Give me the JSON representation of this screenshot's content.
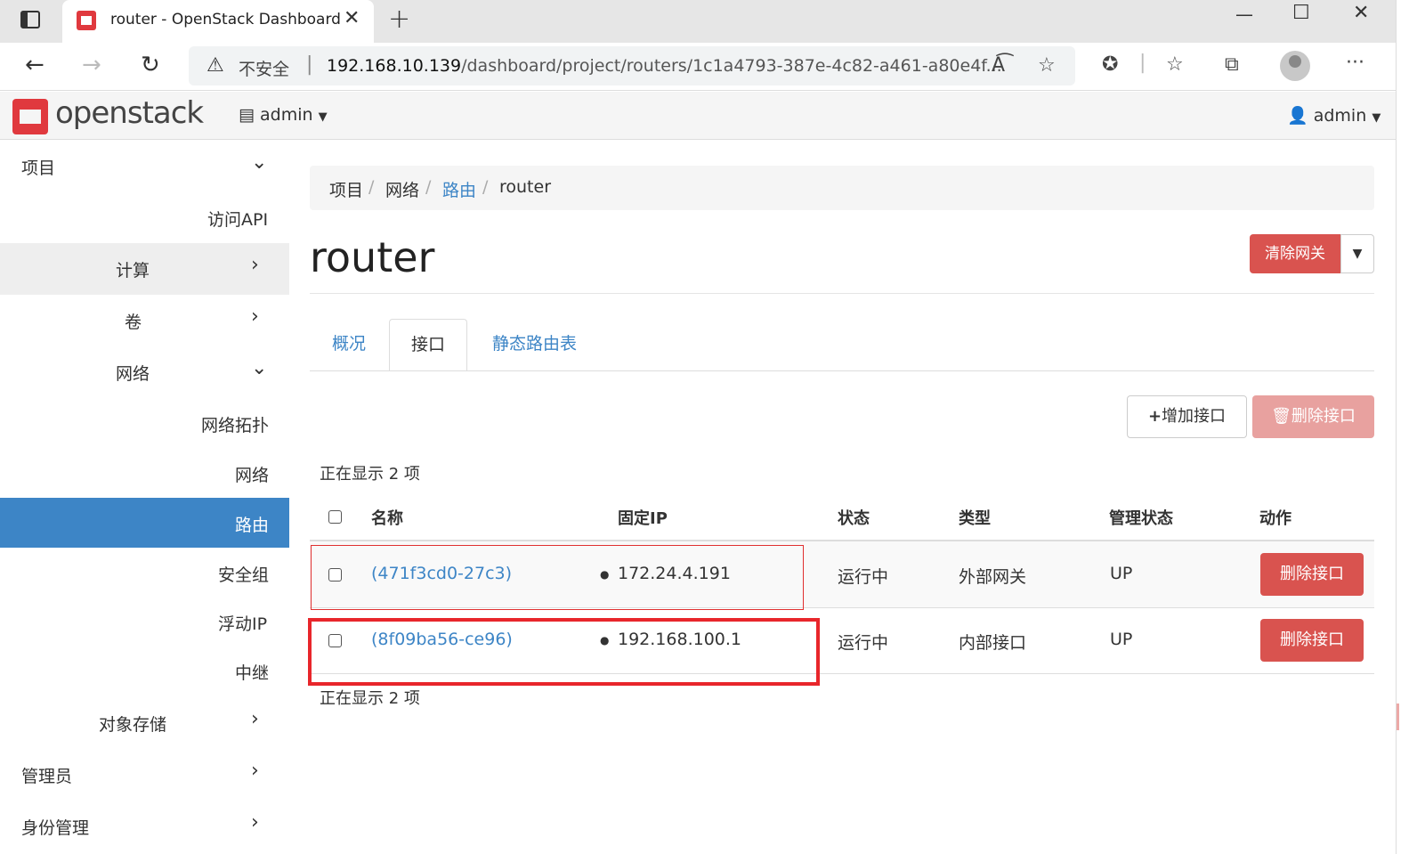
{
  "browser": {
    "tab_title": "router - OpenStack Dashboard",
    "insecure_label": "不安全",
    "url_host": "192.168.10.139",
    "url_path": "/dashboard/project/routers/1c1a4793-387e-4c82-a461-a80e4f..."
  },
  "header": {
    "logo_text": "openstack",
    "project_selector": "admin",
    "user_menu": "admin"
  },
  "sidebar": {
    "project": "项目",
    "api_access": "访问API",
    "compute": "计算",
    "volumes": "卷",
    "network": "网络",
    "net_topology": "网络拓扑",
    "networks": "网络",
    "routers": "路由",
    "security_groups": "安全组",
    "floating_ips": "浮动IP",
    "trunks": "中继",
    "object_store": "对象存储",
    "admin": "管理员",
    "identity": "身份管理"
  },
  "breadcrumb": {
    "item1": "项目",
    "item2": "网络",
    "item3": "路由",
    "current": "router",
    "sep": "/"
  },
  "page": {
    "title": "router",
    "clear_gateway": "清除网关"
  },
  "tabs": {
    "overview": "概况",
    "interfaces": "接口",
    "static_routes": "静态路由表"
  },
  "actions": {
    "add_interface": "增加接口",
    "delete_interfaces": "删除接口"
  },
  "table": {
    "count_top": "正在显示 2 项",
    "count_bottom": "正在显示 2 项",
    "headers": {
      "name": "名称",
      "fixed_ip": "固定IP",
      "status": "状态",
      "type": "类型",
      "admin_state": "管理状态",
      "actions": "动作"
    },
    "rows": [
      {
        "name": "(471f3cd0-27c3)",
        "ip": "172.24.4.191",
        "status": "运行中",
        "type": "外部网关",
        "admin_state": "UP",
        "action": "删除接口"
      },
      {
        "name": "(8f09ba56-ce96)",
        "ip": "192.168.100.1",
        "status": "运行中",
        "type": "内部接口",
        "admin_state": "UP",
        "action": "删除接口"
      }
    ]
  },
  "colors": {
    "brand_red": "#e0393e",
    "link_blue": "#3d85c6",
    "danger": "#d9534f",
    "annotation_red": "#e8262b"
  }
}
